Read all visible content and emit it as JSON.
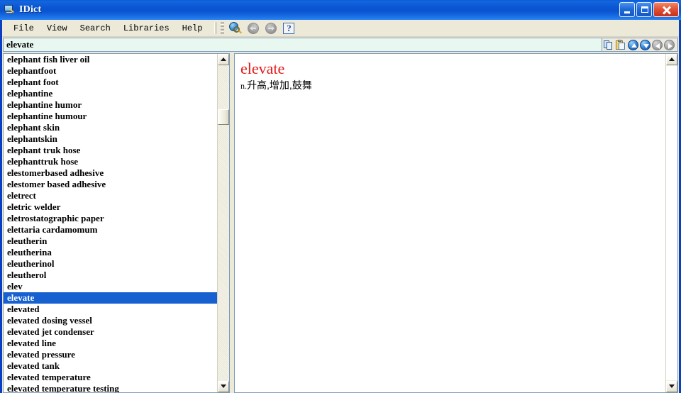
{
  "window": {
    "title": "IDict",
    "icon": "dictionary-icon",
    "controls": {
      "minimize": "_",
      "maximize": "□",
      "close": "✕"
    }
  },
  "menubar": {
    "items": [
      {
        "label": "File"
      },
      {
        "label": "View"
      },
      {
        "label": "Search"
      },
      {
        "label": "Libraries"
      },
      {
        "label": "Help"
      }
    ]
  },
  "toolbar": {
    "buttons": [
      {
        "name": "search-globe-icon",
        "label": ""
      },
      {
        "name": "back-icon",
        "label": ""
      },
      {
        "name": "forward-icon",
        "label": ""
      },
      {
        "name": "help-icon",
        "label": "?"
      }
    ]
  },
  "search": {
    "value": "elevate",
    "placeholder": "",
    "tools": [
      {
        "name": "copy-icon"
      },
      {
        "name": "paste-icon"
      },
      {
        "name": "scroll-up-icon"
      },
      {
        "name": "scroll-down-icon"
      },
      {
        "name": "prev-icon"
      },
      {
        "name": "next-icon"
      }
    ]
  },
  "wordlist": {
    "selected": "elevate",
    "items": [
      "elephant fish liver oil",
      "elephantfoot",
      "elephant foot",
      "elephantine",
      "elephantine humor",
      "elephantine humour",
      "elephant skin",
      "elephantskin",
      "elephant truk hose",
      "elephanttruk hose",
      "elestomerbased adhesive",
      "elestomer based adhesive",
      "eletrect",
      "eletric welder",
      "eletrostatographic paper",
      "elettaria cardamomum",
      "eleutherin",
      "eleutherina",
      "eleutherinol",
      "eleutherol",
      "elev",
      "elevate",
      "elevated",
      "elevated dosing vessel",
      "elevated jet condenser",
      "elevated line",
      "elevated pressure",
      "elevated tank",
      "elevated temperature",
      "elevated temperature testing"
    ]
  },
  "definition": {
    "headword": "elevate",
    "pos": "n.",
    "meaning": "升高,增加,鼓舞"
  },
  "colors": {
    "titlebar_blue": "#0a55d2",
    "selection_blue": "#1660d0",
    "headword_red": "#e11919",
    "chrome": "#ece9d8",
    "search_field": "#e9f7f1"
  }
}
